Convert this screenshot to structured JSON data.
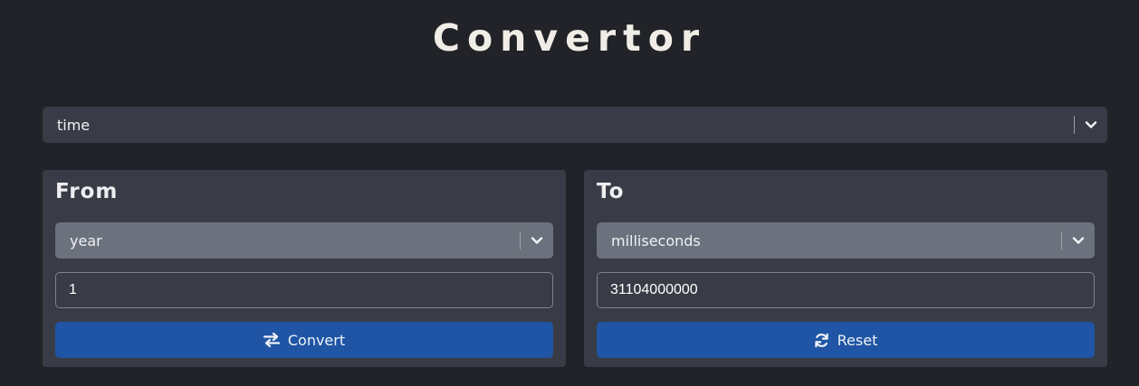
{
  "app": {
    "title": "Convertor"
  },
  "category_select": {
    "selected": "time"
  },
  "from_panel": {
    "heading": "From",
    "unit_selected": "year",
    "value": "1",
    "button_label": "Convert",
    "button_icon": "exchange-icon"
  },
  "to_panel": {
    "heading": "To",
    "unit_selected": "milliseconds",
    "value": "31104000000",
    "button_label": "Reset",
    "button_icon": "sync-icon"
  },
  "colors": {
    "background": "#212328",
    "panel": "#393c46",
    "unit_select": "#6b727d",
    "primary_button": "#1f55a4",
    "title_text": "#f0ede6"
  }
}
